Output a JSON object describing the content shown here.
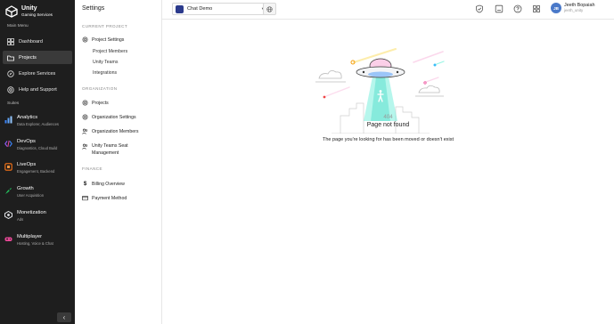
{
  "brand": {
    "title": "Unity",
    "subtitle": "Gaming Services"
  },
  "leftnav": {
    "main_menu_label": "Main Menu",
    "items": [
      {
        "label": "Dashboard",
        "icon": "dashboard-icon"
      },
      {
        "label": "Projects",
        "icon": "projects-icon"
      },
      {
        "label": "Explore Services",
        "icon": "explore-icon"
      },
      {
        "label": "Help and Support",
        "icon": "help-icon"
      }
    ],
    "suites_label": "Suites",
    "suites": [
      {
        "title": "Analytics",
        "subtitle": "Data Explorer, Audiences",
        "color": "#3b82f6"
      },
      {
        "title": "DevOps",
        "subtitle": "Diagnostics, Cloud Build",
        "color": "#8b5cf6"
      },
      {
        "title": "LiveOps",
        "subtitle": "Engagement, Backend",
        "color": "#f97316"
      },
      {
        "title": "Growth",
        "subtitle": "User Acquisition",
        "color": "#22c55e"
      },
      {
        "title": "Monetization",
        "subtitle": "Ads",
        "color": "#e5e7eb"
      },
      {
        "title": "Multiplayer",
        "subtitle": "Hosting, Voice & Chat",
        "color": "#ec4899"
      }
    ],
    "collapse_glyph": "‹"
  },
  "settings": {
    "title": "Settings",
    "current_project_label": "CURRENT PROJECT",
    "project_settings": "Project Settings",
    "project_members": "Project Members",
    "unity_teams": "Unity Teams",
    "integrations": "Integrations",
    "organization_label": "ORGANIZATION",
    "org_projects": "Projects",
    "org_settings": "Organization Settings",
    "org_members": "Organization Members",
    "teams_seat_line1": "Unity Teams Seat",
    "teams_seat_line2": "Management",
    "finance_label": "FINANCE",
    "billing_overview": "Billing Overview",
    "payment_method": "Payment Method"
  },
  "topbar": {
    "project_name": "Chat Demo",
    "caret": "▾",
    "user_initials": "JB",
    "user_name": "Jeeth Bopaiah",
    "user_handle": "jeeth_unity"
  },
  "not_found": {
    "code": "404",
    "title": "Page not found",
    "message": "The page you're looking for has been moved or doesn't exist"
  }
}
